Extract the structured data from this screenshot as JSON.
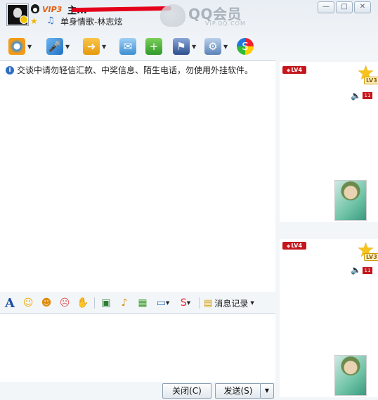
{
  "title_bar": {
    "nickname": "主...",
    "vip_badge": "VIP3",
    "status_text": "单身情歌-林志炫",
    "brand_text": "QQ会员",
    "brand_sub": "VIP.QQ.COM",
    "min_glyph": "—",
    "max_glyph": "□",
    "close_glyph": "✕"
  },
  "chat": {
    "notice": "交谈中请勿轻信汇款、中奖信息、陌生电话，勿使用外挂软件。"
  },
  "formatbar": {
    "font_glyph": "A",
    "history_label": "消息记录"
  },
  "buttons": {
    "close": "关闭(C)",
    "send": "发送(S)"
  },
  "profile_cards": [
    {
      "level_badge": "LV4",
      "star_level": "LV3",
      "count": "11"
    },
    {
      "level_badge": "LV4",
      "star_level": "LV3",
      "count": "11"
    }
  ],
  "colors": {
    "accent_red": "#c4161c",
    "vip_orange": "#e06010",
    "frame_bg": "#f3f6f9"
  }
}
